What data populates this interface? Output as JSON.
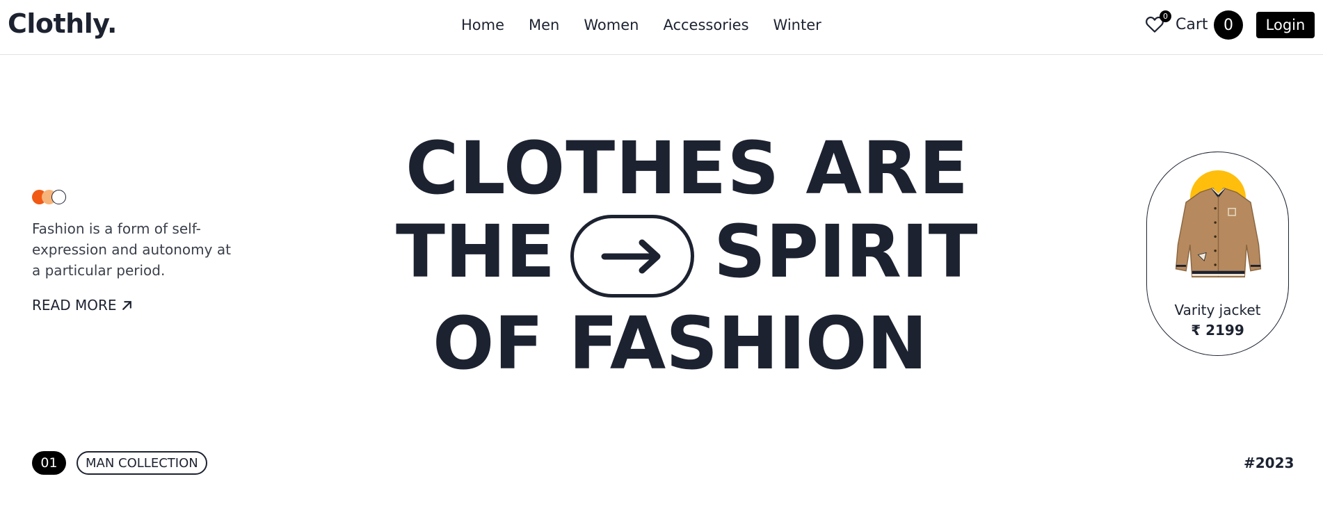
{
  "header": {
    "logo": "Clothly.",
    "nav": [
      "Home",
      "Men",
      "Women",
      "Accessories",
      "Winter"
    ],
    "wishlist_count": "0",
    "cart_label": "Cart",
    "cart_count": "0",
    "login_label": "Login"
  },
  "intro": {
    "dot_colors": [
      "#f05a14",
      "#f7b47a",
      "#ffffff"
    ],
    "text": "Fashion is a form of self-expression and autonomy at a particular period.",
    "read_more": "READ MORE"
  },
  "hero": {
    "line1": "CLOTHES ARE",
    "line2_left": "THE",
    "line2_right": "SPIRIT",
    "line3": "OF FASHION",
    "pill_icon": "arrow-right-icon"
  },
  "product": {
    "name": "Varity jacket",
    "price": "₹ 2199",
    "accent_color": "#ffbe0b"
  },
  "collection": {
    "number": "01",
    "label": "MAN COLLECTION",
    "year": "#2023"
  }
}
